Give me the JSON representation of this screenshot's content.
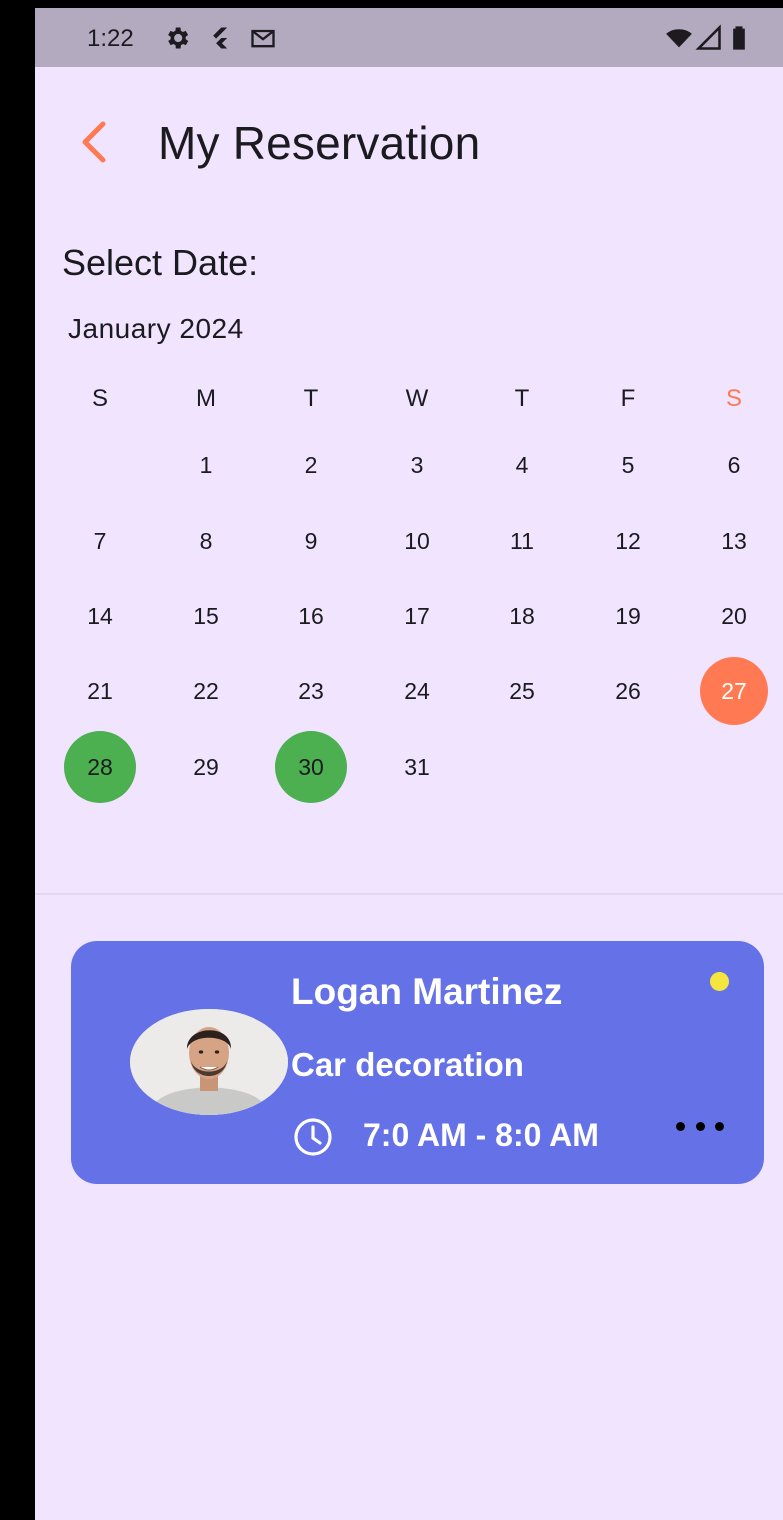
{
  "status_bar": {
    "time": "1:22",
    "icons": [
      "gear-icon",
      "flutter-icon",
      "gmail-icon",
      "wifi-icon",
      "signal-icon",
      "battery-icon"
    ]
  },
  "app_bar": {
    "back_icon": "chevron-left-icon",
    "title": "My Reservation"
  },
  "calendar": {
    "heading": "Select Date:",
    "month": "January 2024",
    "weekdays": [
      "S",
      "M",
      "T",
      "W",
      "T",
      "F",
      "S"
    ],
    "weeks": [
      [
        "",
        "1",
        "2",
        "3",
        "4",
        "5",
        "6"
      ],
      [
        "7",
        "8",
        "9",
        "10",
        "11",
        "12",
        "13"
      ],
      [
        "14",
        "15",
        "16",
        "17",
        "18",
        "19",
        "20"
      ],
      [
        "21",
        "22",
        "23",
        "24",
        "25",
        "26",
        "27"
      ],
      [
        "28",
        "29",
        "30",
        "31",
        "",
        "",
        ""
      ]
    ],
    "today": "27",
    "booked_days": [
      "28",
      "30"
    ],
    "colors": {
      "today": "#ff7a53",
      "booked": "#4caf50",
      "saturday_header": "#ff7a53"
    }
  },
  "reservation": {
    "name": "Logan Martinez",
    "service": "Car decoration",
    "time": "7:0 AM - 8:0 AM",
    "time_icon": "clock-icon",
    "more_icon": "more-horizontal-icon",
    "status_color": "#f5e63f",
    "card_color": "#6571e6"
  }
}
